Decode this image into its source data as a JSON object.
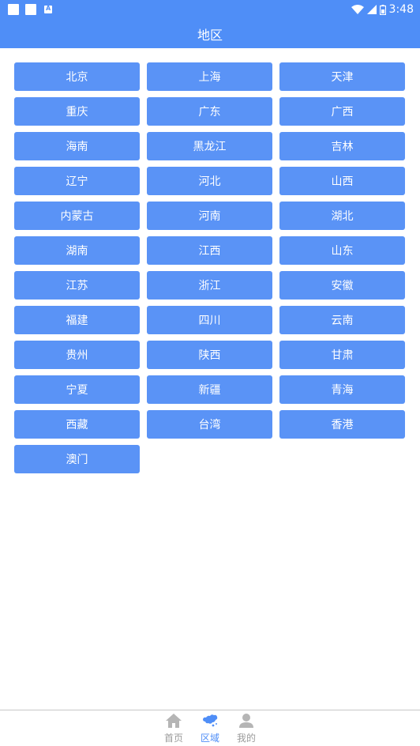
{
  "status_bar": {
    "time": "3:48"
  },
  "app_bar": {
    "title": "地区"
  },
  "regions": [
    "北京",
    "上海",
    "天津",
    "重庆",
    "广东",
    "广西",
    "海南",
    "黑龙江",
    "吉林",
    "辽宁",
    "河北",
    "山西",
    "内蒙古",
    "河南",
    "湖北",
    "湖南",
    "江西",
    "山东",
    "江苏",
    "浙江",
    "安徽",
    "福建",
    "四川",
    "云南",
    "贵州",
    "陕西",
    "甘肃",
    "宁夏",
    "新疆",
    "青海",
    "西藏",
    "台湾",
    "香港",
    "澳门"
  ],
  "bottom_nav": {
    "home_label": "首页",
    "region_label": "区域",
    "mine_label": "我的",
    "active": "region",
    "active_color": "#4f8ef7",
    "inactive_color": "#9b9b9b"
  },
  "colors": {
    "primary": "#4f8ef7",
    "button": "#5a93f6"
  }
}
